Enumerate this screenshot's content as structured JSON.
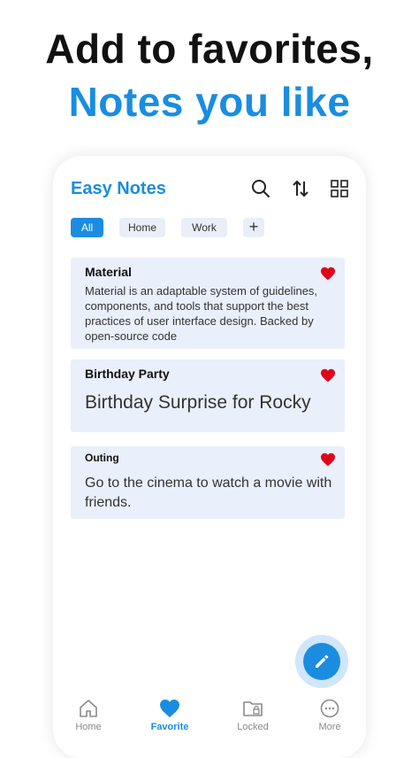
{
  "promo": {
    "line1": "Add to favorites,",
    "line2": "Notes you like"
  },
  "header": {
    "title": "Easy Notes",
    "icons": [
      "search-icon",
      "sort-icon",
      "grid-view-icon"
    ]
  },
  "filters": {
    "chips": [
      "All",
      "Home",
      "Work"
    ],
    "selected": "All",
    "add_icon": "plus-icon"
  },
  "notes": [
    {
      "title": "Material",
      "body": "Material is an adaptable system of guidelines, components, and tools that support the best practices of user interface design. Backed by open-source code",
      "favorite": true
    },
    {
      "title": "Birthday Party",
      "body": "Birthday Surprise for Rocky",
      "favorite": true
    },
    {
      "title": "Outing",
      "body": "Go to the cinema to watch a movie with friends.",
      "favorite": true
    }
  ],
  "fab": {
    "icon": "edit-pencil-icon"
  },
  "bottom_nav": {
    "items": [
      "Home",
      "Favorite",
      "Locked",
      "More"
    ],
    "active": "Favorite"
  },
  "colors": {
    "accent": "#1a8de0",
    "card_bg": "#e9effb",
    "heart": "#e0001b"
  }
}
